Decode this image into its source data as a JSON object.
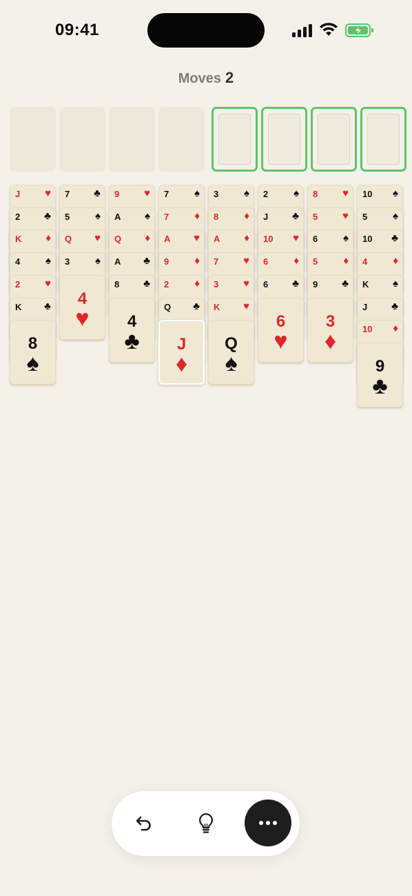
{
  "status": {
    "time": "09:41"
  },
  "header": {
    "moves_label": "Moves",
    "moves_count": "2"
  },
  "slots": {
    "free_cells": [
      null,
      null,
      null,
      null
    ],
    "foundations": [
      null,
      null,
      null,
      null
    ]
  },
  "colors": {
    "red": "#e0262c",
    "black": "#111111",
    "foundation_border": "#5ec46a"
  },
  "suit_symbols": {
    "hearts": "♥",
    "diamonds": "♦",
    "clubs": "♣",
    "spades": "♠"
  },
  "selected_card": {
    "column": 3,
    "index": 6
  },
  "tableau": [
    [
      {
        "rank": "J",
        "suit": "hearts"
      },
      {
        "rank": "2",
        "suit": "clubs"
      },
      {
        "rank": "K",
        "suit": "diamonds"
      },
      {
        "rank": "4",
        "suit": "spades"
      },
      {
        "rank": "2",
        "suit": "hearts"
      },
      {
        "rank": "K",
        "suit": "clubs"
      },
      {
        "rank": "8",
        "suit": "spades"
      }
    ],
    [
      {
        "rank": "7",
        "suit": "clubs"
      },
      {
        "rank": "5",
        "suit": "spades"
      },
      {
        "rank": "Q",
        "suit": "hearts"
      },
      {
        "rank": "3",
        "suit": "spades"
      },
      {
        "rank": "4",
        "suit": "hearts"
      }
    ],
    [
      {
        "rank": "9",
        "suit": "hearts"
      },
      {
        "rank": "A",
        "suit": "spades"
      },
      {
        "rank": "Q",
        "suit": "diamonds"
      },
      {
        "rank": "A",
        "suit": "clubs"
      },
      {
        "rank": "8",
        "suit": "clubs"
      },
      {
        "rank": "4",
        "suit": "clubs"
      }
    ],
    [
      {
        "rank": "7",
        "suit": "spades"
      },
      {
        "rank": "7",
        "suit": "diamonds"
      },
      {
        "rank": "A",
        "suit": "hearts"
      },
      {
        "rank": "9",
        "suit": "diamonds"
      },
      {
        "rank": "2",
        "suit": "diamonds"
      },
      {
        "rank": "Q",
        "suit": "clubs"
      },
      {
        "rank": "J",
        "suit": "diamonds"
      }
    ],
    [
      {
        "rank": "3",
        "suit": "spades"
      },
      {
        "rank": "8",
        "suit": "diamonds"
      },
      {
        "rank": "A",
        "suit": "diamonds"
      },
      {
        "rank": "7",
        "suit": "hearts"
      },
      {
        "rank": "3",
        "suit": "hearts"
      },
      {
        "rank": "K",
        "suit": "hearts"
      },
      {
        "rank": "Q",
        "suit": "spades"
      }
    ],
    [
      {
        "rank": "2",
        "suit": "spades"
      },
      {
        "rank": "J",
        "suit": "clubs"
      },
      {
        "rank": "10",
        "suit": "hearts"
      },
      {
        "rank": "6",
        "suit": "diamonds"
      },
      {
        "rank": "6",
        "suit": "clubs"
      },
      {
        "rank": "6",
        "suit": "hearts"
      }
    ],
    [
      {
        "rank": "8",
        "suit": "hearts"
      },
      {
        "rank": "5",
        "suit": "hearts"
      },
      {
        "rank": "6",
        "suit": "spades"
      },
      {
        "rank": "5",
        "suit": "diamonds"
      },
      {
        "rank": "9",
        "suit": "clubs"
      },
      {
        "rank": "3",
        "suit": "diamonds"
      }
    ],
    [
      {
        "rank": "10",
        "suit": "spades"
      },
      {
        "rank": "5",
        "suit": "spades"
      },
      {
        "rank": "10",
        "suit": "clubs"
      },
      {
        "rank": "4",
        "suit": "diamonds"
      },
      {
        "rank": "K",
        "suit": "spades"
      },
      {
        "rank": "J",
        "suit": "clubs"
      },
      {
        "rank": "10",
        "suit": "diamonds"
      },
      {
        "rank": "9",
        "suit": "clubs"
      }
    ]
  ],
  "toolbar": {
    "undo_icon": "undo-arrow",
    "hint_icon": "lightbulb",
    "more_icon": "ellipsis"
  }
}
